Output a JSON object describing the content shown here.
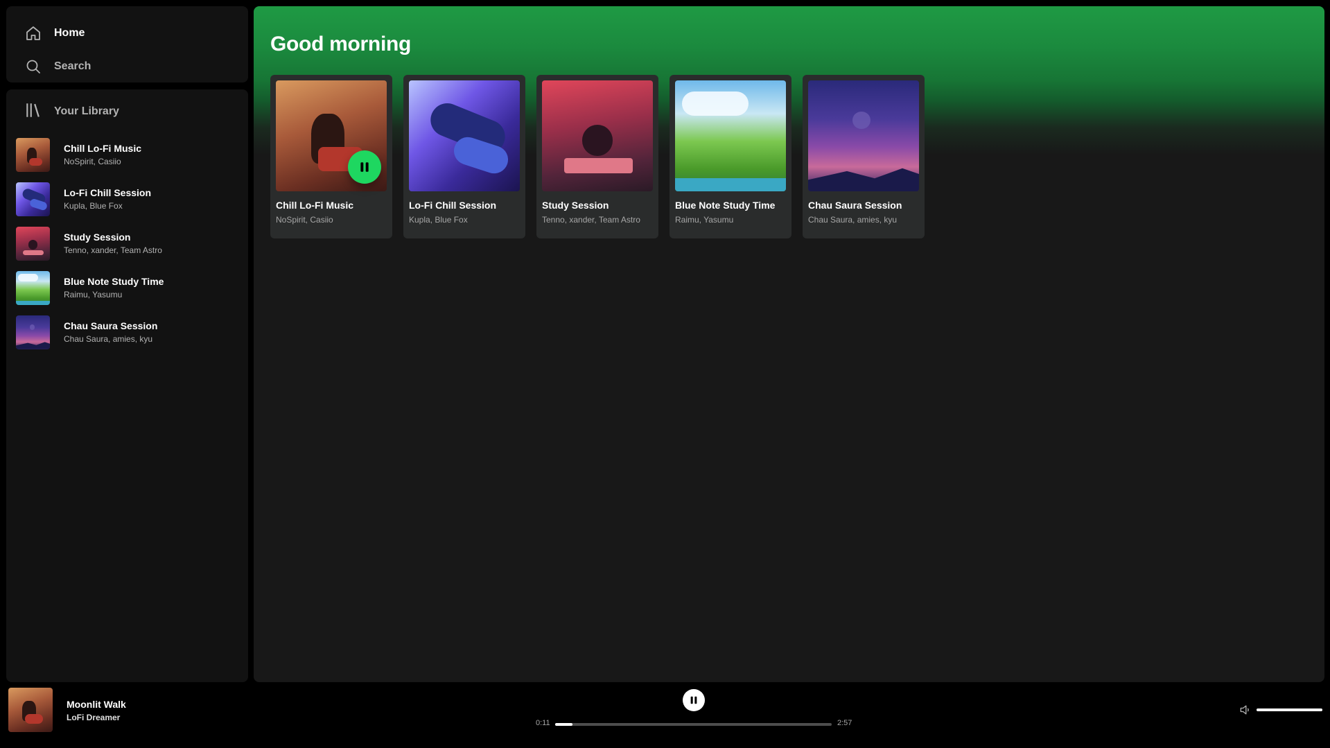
{
  "nav": {
    "home_label": "Home",
    "search_label": "Search",
    "home_icon": "home-icon",
    "search_icon": "search-icon"
  },
  "library": {
    "header_label": "Your Library",
    "header_icon": "library-icon",
    "items": [
      {
        "title": "Chill Lo-Fi Music",
        "subtitle": "NoSpirit, Casiio"
      },
      {
        "title": "Lo-Fi Chill Session",
        "subtitle": "Kupla, Blue Fox"
      },
      {
        "title": "Study Session",
        "subtitle": "Tenno, xander, Team Astro"
      },
      {
        "title": "Blue Note Study Time",
        "subtitle": "Raimu, Yasumu"
      },
      {
        "title": "Chau Saura Session",
        "subtitle": "Chau Saura, amies, kyu"
      }
    ]
  },
  "main": {
    "greeting": "Good morning",
    "cards": [
      {
        "title": "Chill Lo-Fi Music",
        "subtitle": "NoSpirit, Casiio",
        "playing": true
      },
      {
        "title": "Lo-Fi Chill Session",
        "subtitle": "Kupla, Blue Fox",
        "playing": false
      },
      {
        "title": "Study Session",
        "subtitle": "Tenno, xander, Team Astro",
        "playing": false
      },
      {
        "title": "Blue Note Study Time",
        "subtitle": "Raimu, Yasumu",
        "playing": false
      },
      {
        "title": "Chau Saura Session",
        "subtitle": "Chau Saura, amies, kyu",
        "playing": false
      }
    ]
  },
  "player": {
    "track_title": "Moonlit Walk",
    "artist": "LoFi Dreamer",
    "current_time": "0:11",
    "duration": "2:57",
    "progress_fraction": 0.062,
    "volume_fraction": 1.0,
    "state": "playing"
  },
  "colors": {
    "accent": "#1ed760",
    "background": "#000000",
    "panel": "#121212",
    "card": "#2a2c2c",
    "header_gradient": "#1f9a44"
  }
}
